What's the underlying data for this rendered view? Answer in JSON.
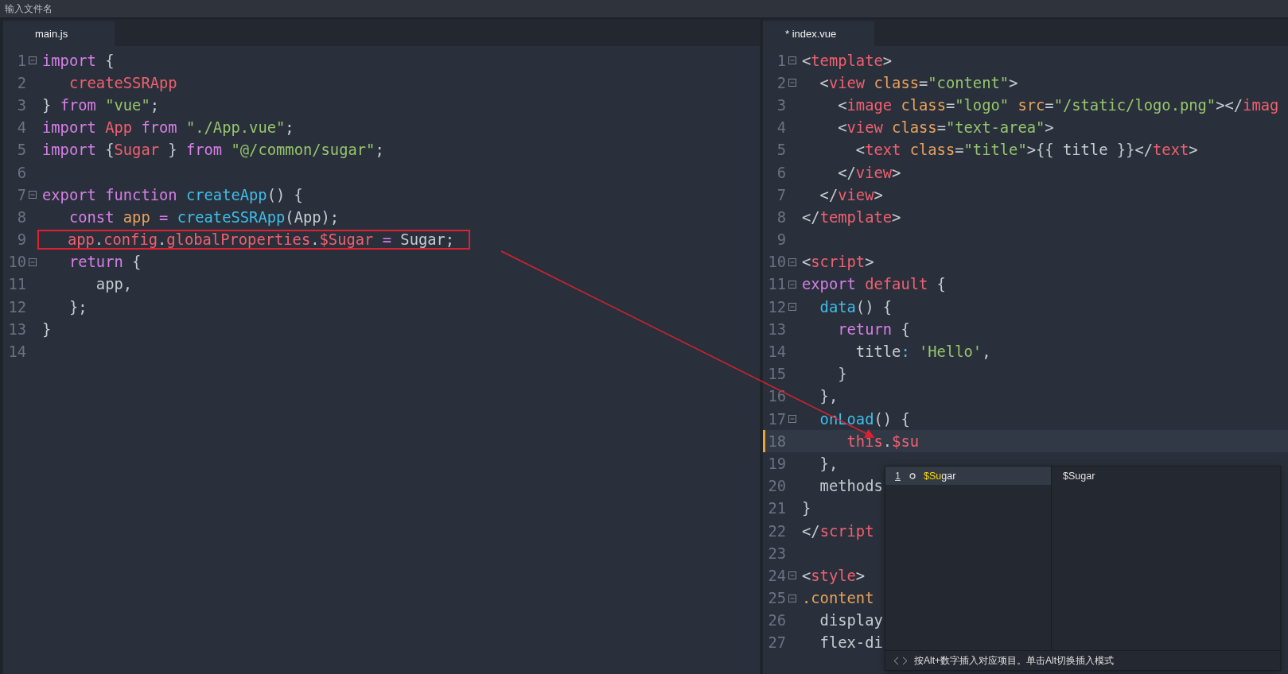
{
  "window": {
    "title": "输入文件名"
  },
  "panes": [
    {
      "tab": {
        "label": "main.js",
        "selected": true
      },
      "lines": [
        {
          "number": "1",
          "foldable": true,
          "tokens": [
            {
              "text": "import",
              "kind": "keyword"
            },
            {
              "text": " {",
              "kind": "plain"
            }
          ]
        },
        {
          "number": "2",
          "foldable": false,
          "tokens": [
            {
              "text": "   createSSRApp",
              "kind": "tag"
            }
          ]
        },
        {
          "number": "3",
          "foldable": false,
          "tokens": [
            {
              "text": "} ",
              "kind": "plain"
            },
            {
              "text": "from",
              "kind": "keyword"
            },
            {
              "text": " \"vue\"",
              "kind": "string"
            },
            {
              "text": ";",
              "kind": "plain"
            }
          ]
        },
        {
          "number": "4",
          "foldable": false,
          "tokens": [
            {
              "text": "import",
              "kind": "keyword"
            },
            {
              "text": " App",
              "kind": "tag"
            },
            {
              "text": " from",
              "kind": "keyword"
            },
            {
              "text": " \"./App.vue\"",
              "kind": "string"
            },
            {
              "text": ";",
              "kind": "plain"
            }
          ]
        },
        {
          "number": "5",
          "foldable": false,
          "tokens": [
            {
              "text": "import",
              "kind": "keyword"
            },
            {
              "text": " {",
              "kind": "plain"
            },
            {
              "text": "Sugar",
              "kind": "tag"
            },
            {
              "text": " } ",
              "kind": "plain"
            },
            {
              "text": "from",
              "kind": "keyword"
            },
            {
              "text": " \"@/common/sugar\"",
              "kind": "string"
            },
            {
              "text": ";",
              "kind": "plain"
            }
          ]
        },
        {
          "number": "6",
          "foldable": false
        },
        {
          "number": "7",
          "foldable": true,
          "tokens": [
            {
              "text": "export",
              "kind": "keyword"
            },
            {
              "text": " function",
              "kind": "keyword"
            },
            {
              "text": " createApp",
              "kind": "function"
            },
            {
              "text": "() {",
              "kind": "plain"
            }
          ]
        },
        {
          "number": "8",
          "foldable": false,
          "tokens": [
            {
              "text": "   const",
              "kind": "keyword"
            },
            {
              "text": " app",
              "kind": "attr"
            },
            {
              "text": " =",
              "kind": "keyword"
            },
            {
              "text": " createSSRApp",
              "kind": "function"
            },
            {
              "text": "(App);",
              "kind": "plain"
            }
          ]
        },
        {
          "number": "9",
          "foldable": false,
          "boxed": true,
          "tokens": [
            {
              "text": "   app",
              "kind": "tag"
            },
            {
              "text": ".",
              "kind": "plain"
            },
            {
              "text": "config",
              "kind": "tag"
            },
            {
              "text": ".",
              "kind": "plain"
            },
            {
              "text": "globalProperties",
              "kind": "tag"
            },
            {
              "text": ".",
              "kind": "plain"
            },
            {
              "text": "$Sugar",
              "kind": "tag"
            },
            {
              "text": " =",
              "kind": "keyword"
            },
            {
              "text": " Sugar;",
              "kind": "plain"
            }
          ]
        },
        {
          "number": "10",
          "foldable": true,
          "tokens": [
            {
              "text": "   return",
              "kind": "keyword"
            },
            {
              "text": " {",
              "kind": "plain"
            }
          ]
        },
        {
          "number": "11",
          "foldable": false,
          "tokens": [
            {
              "text": "      app,",
              "kind": "plain"
            }
          ]
        },
        {
          "number": "12",
          "foldable": false,
          "tokens": [
            {
              "text": "   };",
              "kind": "plain"
            }
          ]
        },
        {
          "number": "13",
          "foldable": false,
          "tokens": [
            {
              "text": "}",
              "kind": "plain"
            }
          ]
        },
        {
          "number": "14",
          "foldable": false
        }
      ]
    },
    {
      "tab": {
        "label": "* index.vue",
        "selected": true
      },
      "lines": [
        {
          "number": "1",
          "foldable": true,
          "tokens": [
            {
              "text": "<",
              "kind": "plain"
            },
            {
              "text": "template",
              "kind": "tag"
            },
            {
              "text": ">",
              "kind": "plain"
            }
          ]
        },
        {
          "number": "2",
          "foldable": true,
          "tokens": [
            {
              "text": "  <",
              "kind": "plain"
            },
            {
              "text": "view",
              "kind": "tag"
            },
            {
              "text": " class",
              "kind": "attr"
            },
            {
              "text": "=",
              "kind": "plain"
            },
            {
              "text": "\"content\"",
              "kind": "string"
            },
            {
              "text": ">",
              "kind": "plain"
            }
          ]
        },
        {
          "number": "3",
          "foldable": false,
          "tokens": [
            {
              "text": "    <",
              "kind": "plain"
            },
            {
              "text": "image",
              "kind": "tag"
            },
            {
              "text": " class",
              "kind": "attr"
            },
            {
              "text": "=",
              "kind": "plain"
            },
            {
              "text": "\"logo\"",
              "kind": "string"
            },
            {
              "text": " src",
              "kind": "attr"
            },
            {
              "text": "=",
              "kind": "plain"
            },
            {
              "text": "\"/static/logo.png\"",
              "kind": "string"
            },
            {
              "text": "></",
              "kind": "plain"
            },
            {
              "text": "imag",
              "kind": "tag"
            }
          ]
        },
        {
          "number": "4",
          "foldable": false,
          "tokens": [
            {
              "text": "    <",
              "kind": "plain"
            },
            {
              "text": "view",
              "kind": "tag"
            },
            {
              "text": " class",
              "kind": "attr"
            },
            {
              "text": "=",
              "kind": "plain"
            },
            {
              "text": "\"text-area\"",
              "kind": "string"
            },
            {
              "text": ">",
              "kind": "plain"
            }
          ]
        },
        {
          "number": "5",
          "foldable": false,
          "tokens": [
            {
              "text": "      <",
              "kind": "plain"
            },
            {
              "text": "text",
              "kind": "tag"
            },
            {
              "text": " class",
              "kind": "attr"
            },
            {
              "text": "=",
              "kind": "plain"
            },
            {
              "text": "\"title\"",
              "kind": "string"
            },
            {
              "text": ">{{ title }}</",
              "kind": "plain"
            },
            {
              "text": "text",
              "kind": "tag"
            },
            {
              "text": ">",
              "kind": "plain"
            }
          ]
        },
        {
          "number": "6",
          "foldable": false,
          "tokens": [
            {
              "text": "    </",
              "kind": "plain"
            },
            {
              "text": "view",
              "kind": "tag"
            },
            {
              "text": ">",
              "kind": "plain"
            }
          ]
        },
        {
          "number": "7",
          "foldable": false,
          "tokens": [
            {
              "text": "  </",
              "kind": "plain"
            },
            {
              "text": "view",
              "kind": "tag"
            },
            {
              "text": ">",
              "kind": "plain"
            }
          ]
        },
        {
          "number": "8",
          "foldable": false,
          "tokens": [
            {
              "text": "</",
              "kind": "plain"
            },
            {
              "text": "template",
              "kind": "tag"
            },
            {
              "text": ">",
              "kind": "plain"
            }
          ]
        },
        {
          "number": "9",
          "foldable": false
        },
        {
          "number": "10",
          "foldable": true,
          "tokens": [
            {
              "text": "<",
              "kind": "plain"
            },
            {
              "text": "script",
              "kind": "tag"
            },
            {
              "text": ">",
              "kind": "plain"
            }
          ]
        },
        {
          "number": "11",
          "foldable": true,
          "tokens": [
            {
              "text": "export",
              "kind": "keyword"
            },
            {
              "text": " default",
              "kind": "tag"
            },
            {
              "text": " {",
              "kind": "plain"
            }
          ]
        },
        {
          "number": "12",
          "foldable": true,
          "tokens": [
            {
              "text": "  data",
              "kind": "function"
            },
            {
              "text": "() {",
              "kind": "plain"
            }
          ]
        },
        {
          "number": "13",
          "foldable": false,
          "tokens": [
            {
              "text": "    return",
              "kind": "keyword"
            },
            {
              "text": " {",
              "kind": "plain"
            }
          ]
        },
        {
          "number": "14",
          "foldable": false,
          "tokens": [
            {
              "text": "      title",
              "kind": "plain"
            },
            {
              "text": ":",
              "kind": "function"
            },
            {
              "text": " 'Hello'",
              "kind": "string"
            },
            {
              "text": ",",
              "kind": "plain"
            }
          ]
        },
        {
          "number": "15",
          "foldable": false,
          "tokens": [
            {
              "text": "    }",
              "kind": "plain"
            }
          ]
        },
        {
          "number": "16",
          "foldable": false,
          "tokens": [
            {
              "text": "  },",
              "kind": "plain"
            }
          ]
        },
        {
          "number": "17",
          "foldable": true,
          "tokens": [
            {
              "text": "  onLoad",
              "kind": "function"
            },
            {
              "text": "() {",
              "kind": "plain"
            }
          ]
        },
        {
          "number": "18",
          "foldable": false,
          "current": true,
          "tokens": [
            {
              "text": "     this",
              "kind": "tag"
            },
            {
              "text": ".",
              "kind": "plain"
            },
            {
              "text": "$su",
              "kind": "tag"
            }
          ]
        },
        {
          "number": "19",
          "foldable": false,
          "tokens": [
            {
              "text": "  },",
              "kind": "plain"
            }
          ]
        },
        {
          "number": "20",
          "foldable": false,
          "tokens": [
            {
              "text": "  methods",
              "kind": "plain"
            }
          ]
        },
        {
          "number": "21",
          "foldable": false,
          "tokens": [
            {
              "text": "}",
              "kind": "plain"
            }
          ]
        },
        {
          "number": "22",
          "foldable": false,
          "tokens": [
            {
              "text": "</",
              "kind": "plain"
            },
            {
              "text": "script",
              "kind": "tag"
            }
          ]
        },
        {
          "number": "23",
          "foldable": false
        },
        {
          "number": "24",
          "foldable": true,
          "tokens": [
            {
              "text": "<",
              "kind": "plain"
            },
            {
              "text": "style",
              "kind": "tag"
            },
            {
              "text": ">",
              "kind": "plain"
            }
          ]
        },
        {
          "number": "25",
          "foldable": true,
          "tokens": [
            {
              "text": ".content",
              "kind": "attr"
            }
          ]
        },
        {
          "number": "26",
          "foldable": false,
          "tokens": [
            {
              "text": "  display",
              "kind": "plain"
            }
          ]
        },
        {
          "number": "27",
          "foldable": false,
          "tokens": [
            {
              "text": "  flex-di",
              "kind": "plain"
            }
          ]
        }
      ]
    }
  ],
  "autocomplete": {
    "items": [
      {
        "index": "1",
        "match": "$Su",
        "rest": "gar",
        "selected": true
      }
    ],
    "detail": "$Sugar",
    "hint": "按Alt+数字插入对应项目。单击Alt切换插入模式"
  }
}
